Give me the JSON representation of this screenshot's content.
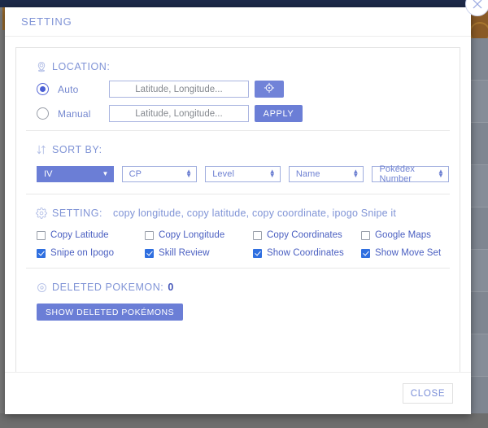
{
  "dialog": {
    "title": "SETTING",
    "close_icon": "close-x-icon",
    "footer_close_label": "CLOSE"
  },
  "location": {
    "heading": "LOCATION:",
    "icon": "map-pin-icon",
    "auto": {
      "label": "Auto",
      "selected": true,
      "input_value": "",
      "input_placeholder": "Latitude, Longitude...",
      "button_icon": "crosshair-gps-icon"
    },
    "manual": {
      "label": "Manual",
      "selected": false,
      "input_value": "",
      "input_placeholder": "Latitude, Longitude...",
      "button_label": "APPLY"
    }
  },
  "sort_by": {
    "heading": "SORT BY:",
    "icon": "sort-arrows-icon",
    "options": [
      {
        "label": "IV",
        "active": true,
        "indicator": "chevron-down-icon"
      },
      {
        "label": "CP",
        "active": false,
        "indicator": "up-down-arrows-icon"
      },
      {
        "label": "Level",
        "active": false,
        "indicator": "up-down-arrows-icon"
      },
      {
        "label": "Name",
        "active": false,
        "indicator": "up-down-arrows-icon"
      },
      {
        "label": "Pokédex Number",
        "active": false,
        "indicator": "up-down-arrows-icon"
      }
    ]
  },
  "setting": {
    "heading": "SETTING:",
    "icon": "gear-icon",
    "description": "copy longitude, copy latitude, copy coordinate, ipogo Snipe it",
    "checkboxes": [
      {
        "label": "Copy Latitude",
        "checked": false
      },
      {
        "label": "Copy Longitude",
        "checked": false
      },
      {
        "label": "Copy Coordinates",
        "checked": false
      },
      {
        "label": "Google Maps",
        "checked": false
      },
      {
        "label": "Snipe on Ipogo",
        "checked": true
      },
      {
        "label": "Skill Review",
        "checked": true
      },
      {
        "label": "Show Coordinates",
        "checked": true
      },
      {
        "label": "Show Move Set",
        "checked": true
      }
    ]
  },
  "deleted": {
    "icon": "pokeball-icon",
    "heading": "DELETED POKEMON:",
    "count": "0",
    "button_label": "SHOW DELETED POKÉMONS"
  },
  "colors": {
    "accent_blue": "#6b7ed6",
    "heading_blue": "#8094d6",
    "checkbox_blue": "#2f6fe0",
    "topbar_navy": "#1d2a4a"
  }
}
